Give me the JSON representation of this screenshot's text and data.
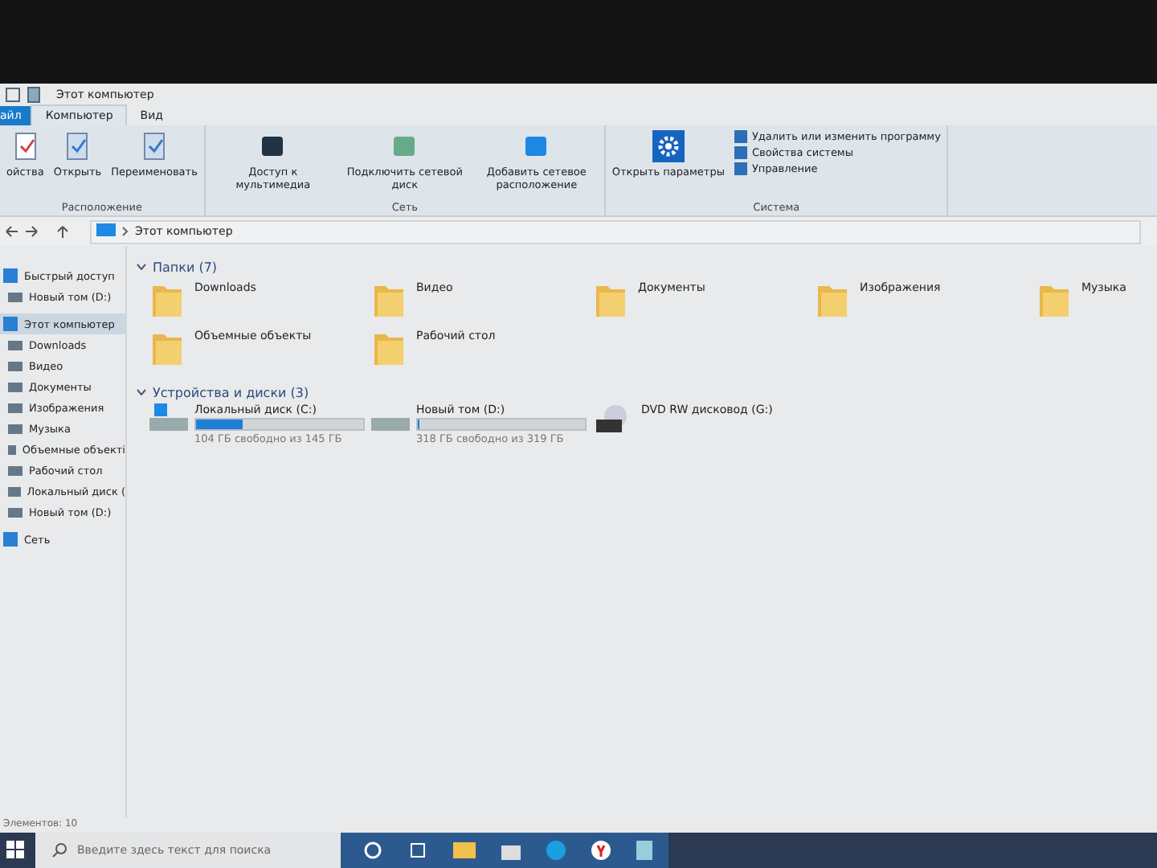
{
  "window": {
    "title": "Этот компьютер"
  },
  "tabs": [
    {
      "label": "айл",
      "selected": false,
      "kind": "file"
    },
    {
      "label": "Компьютер",
      "selected": true,
      "kind": "tab"
    },
    {
      "label": "Вид",
      "selected": false,
      "kind": "tab"
    }
  ],
  "ribbon": {
    "groups": [
      {
        "name": "Расположение",
        "buttons": [
          "ойства",
          "Открыть",
          "Переименовать"
        ]
      },
      {
        "name": "Сеть",
        "buttons": [
          "Доступ к мультимедиа",
          "Подключить сетевой диск",
          "Добавить сетевое расположение"
        ]
      },
      {
        "name": "Система",
        "buttons": [
          "Открыть параметры"
        ],
        "small_buttons": [
          "Удалить или изменить программу",
          "Свойства системы",
          "Управление"
        ]
      }
    ]
  },
  "address": {
    "path": "Этот компьютер"
  },
  "sidebar": {
    "items": [
      {
        "label": "Быстрый доступ",
        "selected": false,
        "children": [
          {
            "label": "Новый том (D:)",
            "selected": false
          }
        ]
      },
      {
        "label": "Этот компьютер",
        "selected": true,
        "children": [
          {
            "label": "Downloads",
            "selected": false
          },
          {
            "label": "Видео",
            "selected": false
          },
          {
            "label": "Документы",
            "selected": false
          },
          {
            "label": "Изображения",
            "selected": false
          },
          {
            "label": "Музыка",
            "selected": false
          },
          {
            "label": "Объемные объекті",
            "selected": false
          },
          {
            "label": "Рабочий стол",
            "selected": false
          },
          {
            "label": "Локальный диск (",
            "selected": false
          },
          {
            "label": "Новый том (D:)",
            "selected": false
          }
        ]
      },
      {
        "label": "Сеть",
        "selected": false
      }
    ]
  },
  "folders": {
    "title": "Папки (7)",
    "items": [
      "Downloads",
      "Видео",
      "Документы",
      "Изображения",
      "Музыка",
      "Объемные объекты",
      "Рабочий стол"
    ]
  },
  "drives": {
    "title": "Устройства и диски (3)",
    "items": [
      {
        "name": "Локальный диск (C:)",
        "kind": "disk",
        "level": 0.28,
        "free": "104 ГБ свободно из 145 ГБ"
      },
      {
        "name": "Новый том (D:)",
        "kind": "disk",
        "level": 0.003,
        "free": "318 ГБ свободно из 319 ГБ"
      },
      {
        "name": "DVD RW дисковод (G:)",
        "kind": "optical"
      }
    ]
  },
  "status_bar": {
    "text": "Элементов: 10"
  },
  "taskbar": {
    "search": {
      "placeholder": "Введите здесь текст для поиска"
    }
  }
}
